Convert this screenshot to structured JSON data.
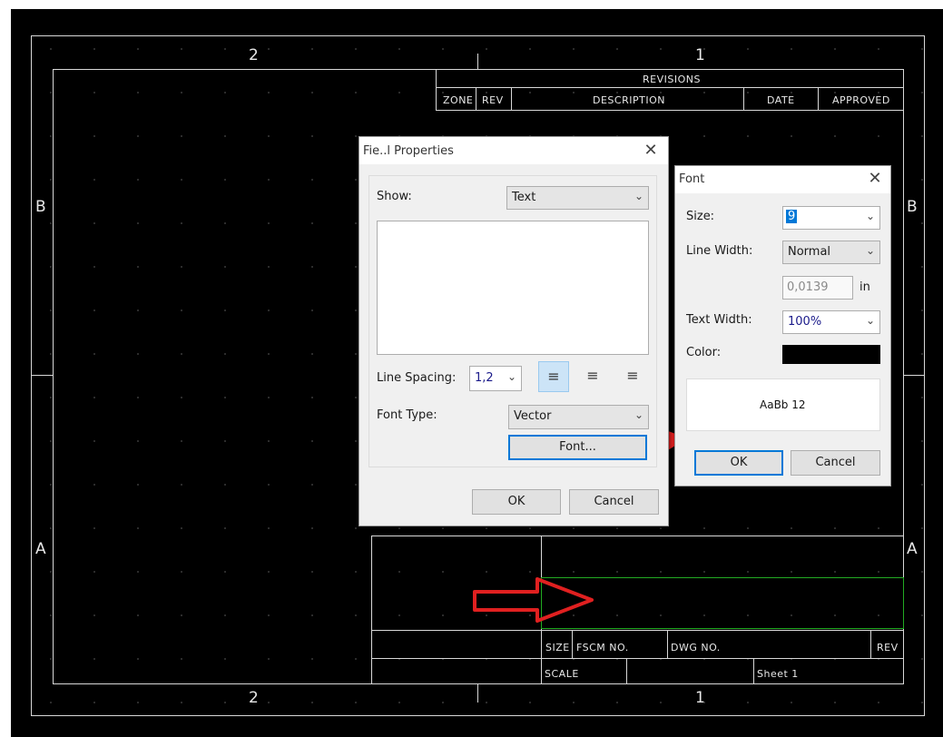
{
  "drawing": {
    "zones_top": [
      "2",
      "1"
    ],
    "zones_bottom": [
      "2",
      "1"
    ],
    "zones_left": [
      "B",
      "A"
    ],
    "zones_right": [
      "B",
      "A"
    ],
    "revisions": {
      "title": "REVISIONS",
      "columns": [
        "ZONE",
        "REV",
        "DESCRIPTION",
        "DATE",
        "APPROVED"
      ]
    },
    "title_block": {
      "size_label": "SIZE",
      "fscm_label": "FSCM NO.",
      "dwg_label": "DWG NO.",
      "rev_label": "REV",
      "scale_label": "SCALE",
      "sheet_label": "Sheet 1"
    }
  },
  "field_properties": {
    "title": "Fie..l Properties",
    "show_label": "Show:",
    "show_value": "Text",
    "line_spacing_label": "Line Spacing:",
    "line_spacing_value": "1,2",
    "font_type_label": "Font Type:",
    "font_type_value": "Vector",
    "font_button": "Font...",
    "ok": "OK",
    "cancel": "Cancel",
    "close": "✕"
  },
  "font_dialog": {
    "title": "Font",
    "size_label": "Size:",
    "size_value": "9",
    "line_width_label": "Line Width:",
    "line_width_value": "Normal",
    "line_width_number": "0,0139",
    "unit": "in",
    "text_width_label": "Text Width:",
    "text_width_value": "100%",
    "color_label": "Color:",
    "color_value": "#000000",
    "preview_text": "AaBb 12",
    "ok": "OK",
    "cancel": "Cancel",
    "close": "✕"
  },
  "colors": {
    "canvas": "#000000",
    "drawing_line": "#d8d8d8",
    "highlight_box": "#22aa22",
    "annotation_arrow": "#e02020",
    "focus": "#0078d7"
  },
  "icons": {
    "align_left": "align-left-icon",
    "align_center": "align-center-icon",
    "align_right": "align-right-icon",
    "dropdown": "chevron-down-icon"
  }
}
